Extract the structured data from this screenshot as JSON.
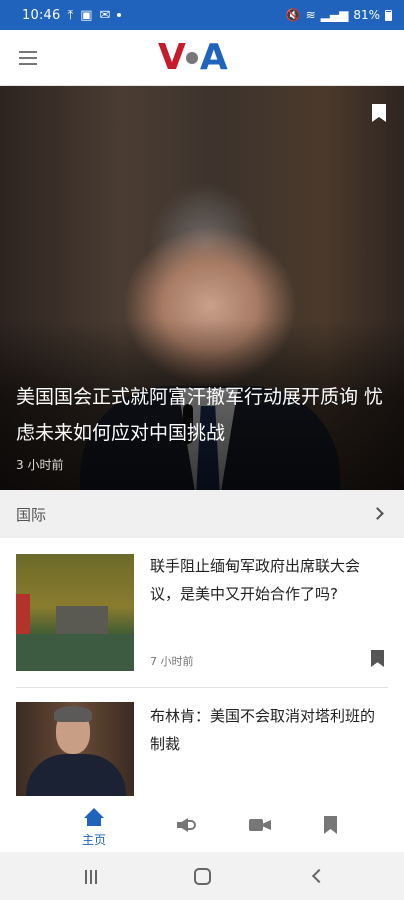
{
  "status_bar": {
    "time": "10:46",
    "battery": "81%"
  },
  "header": {
    "logo_text": "VOA"
  },
  "hero": {
    "title": "美国国会正式就阿富汗撤军行动展开质询 忧虑未来如何应对中国挑战",
    "time": "3 小时前"
  },
  "section": {
    "title": "国际"
  },
  "articles": [
    {
      "title": "联手阻止缅甸军政府出席联大会议，是美中又开始合作了吗?",
      "time": "7 小时前"
    },
    {
      "title": "布林肯：美国不会取消对塔利班的制裁"
    }
  ],
  "bottom_nav": {
    "home_label": "主页"
  },
  "colors": {
    "brand_blue": "#1f63bc",
    "brand_red": "#c71b2b"
  }
}
